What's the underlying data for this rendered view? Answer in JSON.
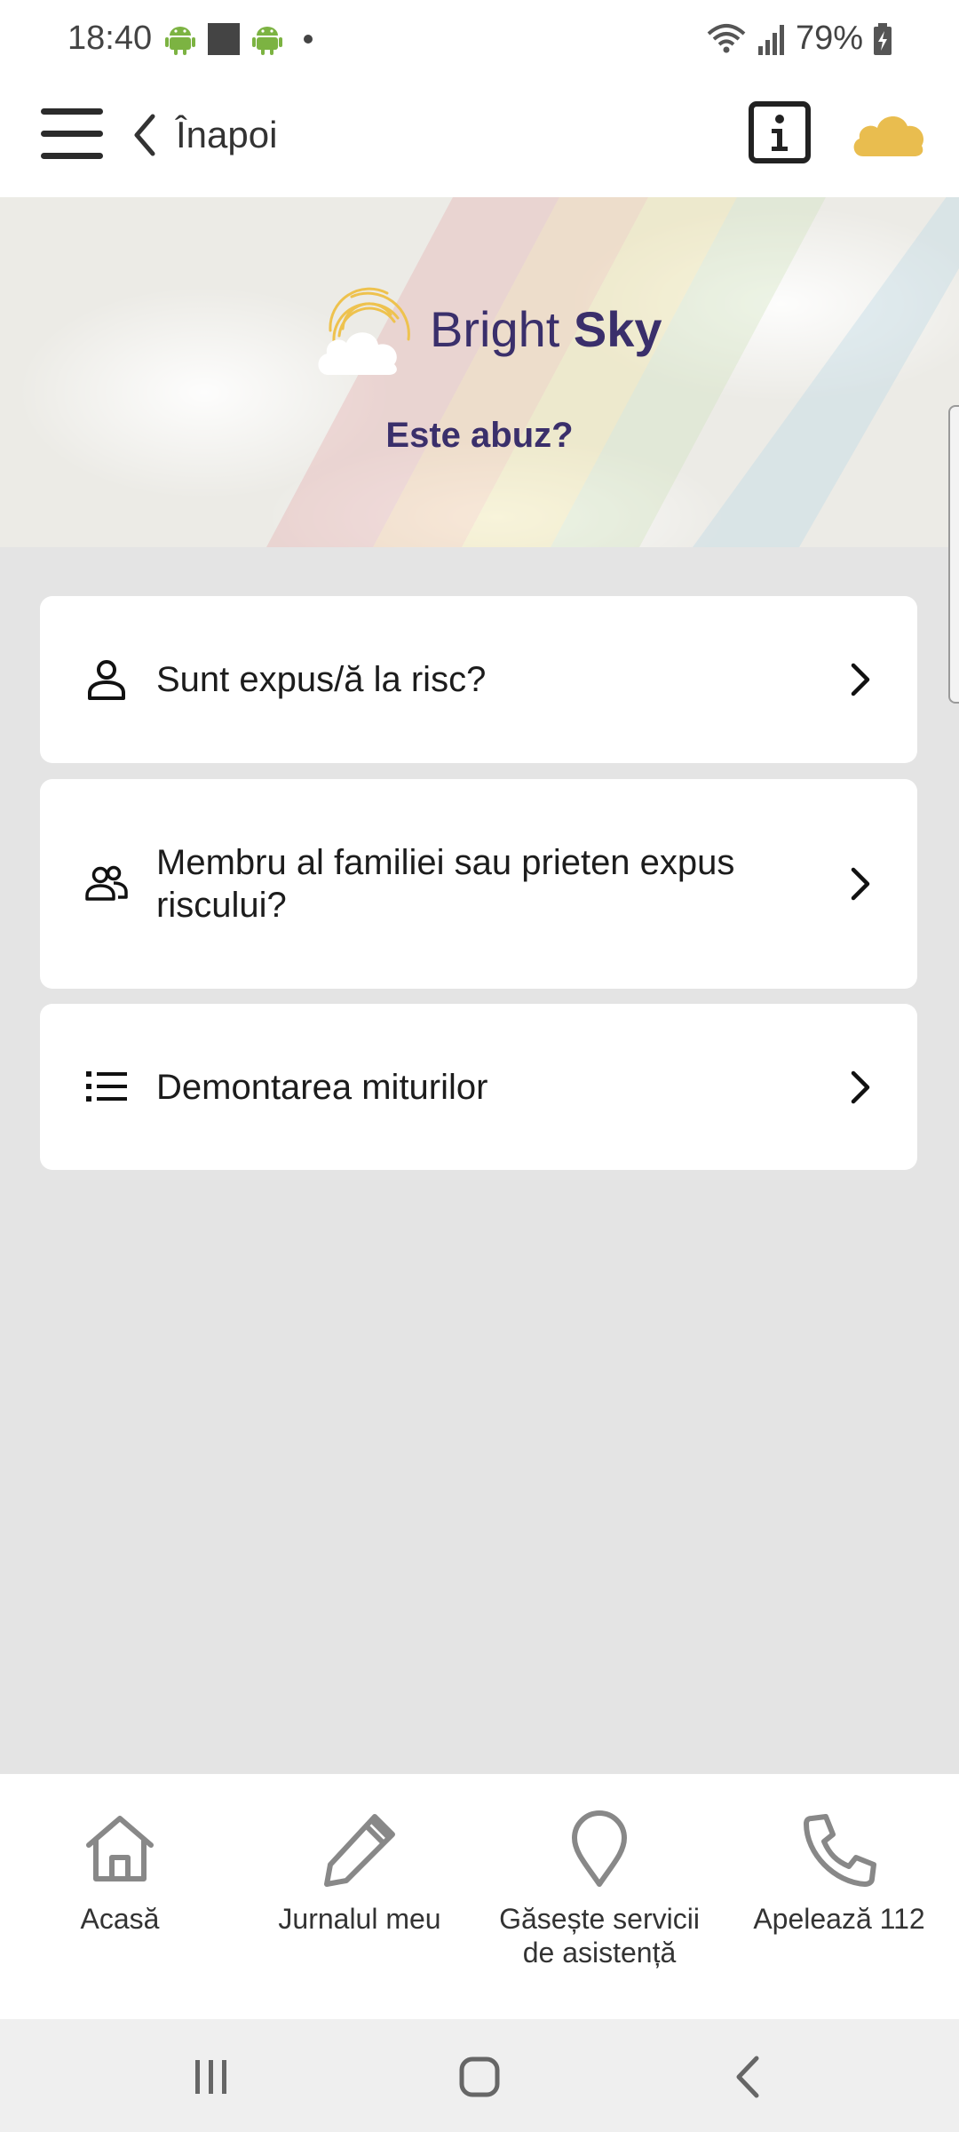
{
  "status_bar": {
    "time": "18:40",
    "battery": "79%",
    "icons": [
      "android-icon",
      "square-notification-icon",
      "android-icon",
      "dot-icon",
      "wifi-icon",
      "signal-icon",
      "battery-charging-icon"
    ]
  },
  "header": {
    "back_label": "Înapoi",
    "icons": [
      "hamburger-menu-icon",
      "chevron-left-icon",
      "info-icon",
      "cloud-icon"
    ]
  },
  "hero": {
    "brand_light": "Bright",
    "brand_bold": "Sky",
    "subtitle": "Este abuz?"
  },
  "cards": [
    {
      "icon": "person-icon",
      "label": "Sunt expus/ă la risc?"
    },
    {
      "icon": "people-icon",
      "label": "Membru al familiei sau prieten expus riscului?"
    },
    {
      "icon": "list-icon",
      "label": "Demontarea miturilor"
    }
  ],
  "bottom_nav": [
    {
      "icon": "home-icon",
      "label": "Acasă"
    },
    {
      "icon": "pencil-icon",
      "label": "Jurnalul meu"
    },
    {
      "icon": "location-pin-icon",
      "label": "Găsește servicii de asistență"
    },
    {
      "icon": "phone-icon",
      "label": "Apelează 112"
    }
  ],
  "colors": {
    "brand_purple": "#3a2f6b",
    "cloud_yellow": "#e9bd4f",
    "background": "#e4e4e4"
  }
}
